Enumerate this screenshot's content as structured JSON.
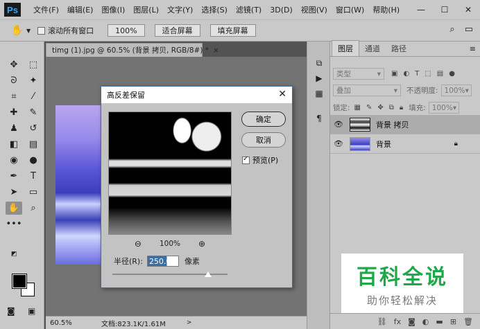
{
  "app": {
    "logo": "Ps"
  },
  "menu": [
    "文件(F)",
    "编辑(E)",
    "图像(I)",
    "图层(L)",
    "文字(Y)",
    "选择(S)",
    "滤镜(T)",
    "3D(D)",
    "视图(V)",
    "窗口(W)",
    "帮助(H)"
  ],
  "window_controls": {
    "minimize": "—",
    "maximize": "☐",
    "close": "✕"
  },
  "options": {
    "scroll_all_label": "滚动所有窗口",
    "zoom_btn": "100%",
    "fit_screen_btn": "适合屏幕",
    "fill_screen_btn": "填充屏幕"
  },
  "document": {
    "tab_title": "timg (1).jpg @ 60.5% (背景 拷贝, RGB/8#) *",
    "tab_close": "×",
    "zoom": "60.5%",
    "info": "文档:823.1K/1.61M",
    "arrow": ">"
  },
  "layers_panel": {
    "tabs": [
      "图层",
      "通道",
      "路径"
    ],
    "menu": "≡",
    "filter_kind": "类型",
    "blend_mode": "叠加",
    "opacity_label": "不透明度:",
    "opacity_value": "100%",
    "lock_label": "锁定:",
    "fill_label": "填充:",
    "fill_value": "100%",
    "layers": [
      {
        "name": "背景 拷贝"
      },
      {
        "name": "背景"
      }
    ]
  },
  "dialog": {
    "title": "高反差保留",
    "close": "✕",
    "ok": "确定",
    "cancel": "取消",
    "preview_label": "预览(P)",
    "preview_checked": true,
    "zoom_value": "100%",
    "radius_label": "半径(R):",
    "radius_value": "250.0",
    "radius_unit": "像素",
    "slider_fraction": 0.83
  },
  "watermark": {
    "title": "百科全说",
    "subtitle": "助你轻松解决"
  }
}
